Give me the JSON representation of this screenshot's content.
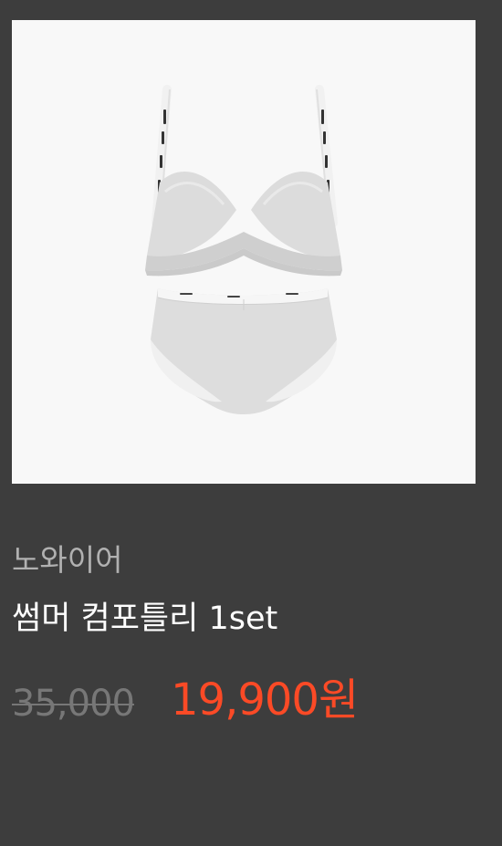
{
  "product": {
    "image_alt": "Bra and panty set product photo",
    "brand": "노와이어",
    "name": "썸머 컴포틀리 1set",
    "original_price": "35,000",
    "sale_price": "19,900원",
    "colors": {
      "background": "#3d3d3d",
      "image_bg": "#f8f8f8",
      "brand_text": "#b1b1b1",
      "name_text": "#ffffff",
      "original_price_text": "#777777",
      "sale_price_text": "#fb4a26"
    }
  }
}
